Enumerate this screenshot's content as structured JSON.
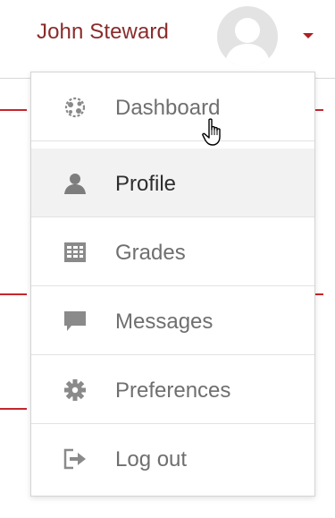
{
  "user": {
    "name": "John Steward"
  },
  "menu": {
    "items": [
      {
        "label": "Dashboard",
        "icon": "dashboard-icon",
        "active": false
      },
      {
        "label": "Profile",
        "icon": "user-icon",
        "active": true
      },
      {
        "label": "Grades",
        "icon": "grades-table-icon",
        "active": false
      },
      {
        "label": "Messages",
        "icon": "message-bubble-icon",
        "active": false
      },
      {
        "label": "Preferences",
        "icon": "gear-icon",
        "active": false
      },
      {
        "label": "Log out",
        "icon": "sign-out-icon",
        "active": false
      }
    ]
  },
  "colors": {
    "username": "#8b2b2b",
    "accent": "#b11e24",
    "icon": "#8a8a8a",
    "active_bg": "#f2f2f2"
  }
}
